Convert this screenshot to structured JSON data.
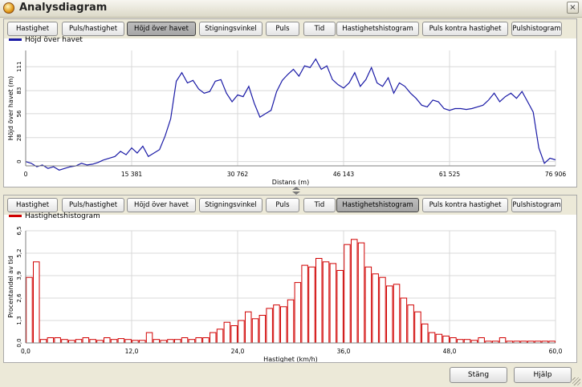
{
  "window": {
    "title": "Analysdiagram",
    "close_label": "×"
  },
  "tabs": [
    "Hastighet",
    "Puls/hastighet",
    "Höjd över havet",
    "Stigningsvinkel",
    "Puls",
    "Tid",
    "Hastighetshistogram",
    "Puls kontra hastighet",
    "Pulshistogram"
  ],
  "top_active_tab": "Höjd över havet",
  "bottom_active_tab": "Hastighetshistogram",
  "colors": {
    "line": "#1a1aa6",
    "bars": "#d00000",
    "active_tab": "#b0b0b0"
  },
  "chart_data": [
    {
      "type": "line",
      "legend": "Höjd över havet",
      "xlabel": "Distans (m)",
      "ylabel": "Höjd över havet (m)",
      "xlim": [
        0,
        76906
      ],
      "ylim": [
        -5,
        130
      ],
      "xticks": [
        "0",
        "15 381",
        "30 762",
        "46 143",
        "61 525",
        "76 906"
      ],
      "yticks": [
        "0",
        "28",
        "56",
        "83",
        "111"
      ],
      "x": [
        0,
        1000,
        2000,
        3000,
        4000,
        5000,
        6000,
        7000,
        8000,
        9000,
        10000,
        11000,
        12000,
        13000,
        14000,
        15000,
        16000,
        17000,
        18000,
        19000,
        20000,
        21000,
        22000,
        23000,
        24000,
        25000,
        26000,
        27000,
        28000,
        29000,
        30000,
        31000,
        32000,
        33000,
        34000,
        35000,
        36000,
        37000,
        38000,
        39000,
        40000,
        41000,
        42000,
        43000,
        44000,
        45000,
        46000,
        47000,
        48000,
        49000,
        50000,
        51000,
        52000,
        53000,
        54000,
        55000,
        56000,
        57000,
        58000,
        59000,
        60000,
        61000,
        62000,
        63000,
        64000,
        65000,
        66000,
        67000,
        68000,
        69000,
        70000,
        71000,
        72000,
        73000,
        74000,
        75000,
        76000,
        76906
      ],
      "y": [
        0,
        -2,
        -6,
        -4,
        -8,
        -6,
        -10,
        -8,
        -6,
        -5,
        -2,
        -4,
        -3,
        -1,
        2,
        4,
        6,
        12,
        8,
        16,
        10,
        18,
        6,
        10,
        14,
        30,
        50,
        94,
        104,
        92,
        95,
        85,
        80,
        82,
        94,
        96,
        80,
        70,
        78,
        76,
        88,
        68,
        52,
        56,
        60,
        82,
        95,
        102,
        108,
        100,
        112,
        110,
        120,
        108,
        112,
        96,
        90,
        86,
        92,
        104,
        88,
        96,
        110,
        92,
        88,
        98,
        80,
        92,
        88,
        80,
        74,
        66,
        64,
        72,
        70,
        62,
        60,
        62,
        62,
        61,
        62,
        64,
        66,
        72,
        80,
        70,
        76,
        80,
        74,
        82,
        70,
        58,
        16,
        -2,
        4,
        2
      ],
      "note": ""
    },
    {
      "type": "bar",
      "legend": "Hastighetshistogram",
      "xlabel": "Hastighet (km/h)",
      "ylabel": "Procentandel av tid",
      "xlim": [
        0,
        60
      ],
      "ylim": [
        0,
        6.5
      ],
      "xticks": [
        "0,0",
        "12,0",
        "24,0",
        "36,0",
        "48,0",
        "60,0"
      ],
      "yticks": [
        "0,0",
        "1,3",
        "2,6",
        "3,9",
        "5,2",
        "6,5"
      ],
      "bar_width": 0.8,
      "x": [
        0.0,
        0.8,
        1.6,
        2.4,
        3.2,
        4.0,
        4.8,
        5.6,
        6.4,
        7.2,
        8.0,
        8.8,
        9.6,
        10.4,
        11.2,
        12.0,
        12.8,
        13.6,
        14.4,
        15.2,
        16.0,
        16.8,
        17.6,
        18.4,
        19.2,
        20.0,
        20.8,
        21.6,
        22.4,
        23.2,
        24.0,
        24.8,
        25.6,
        26.4,
        27.2,
        28.0,
        28.8,
        29.6,
        30.4,
        31.2,
        32.0,
        32.8,
        33.6,
        34.4,
        35.2,
        36.0,
        36.8,
        37.6,
        38.4,
        39.2,
        40.0,
        40.8,
        41.6,
        42.4,
        43.2,
        44.0,
        44.8,
        45.6,
        46.4,
        47.2,
        48.0,
        48.8,
        49.6,
        50.4,
        51.2,
        52.0,
        52.8,
        53.6,
        54.4,
        55.2,
        56.0,
        56.8,
        57.6,
        58.4,
        59.2
      ],
      "values": [
        3.8,
        4.7,
        0.2,
        0.3,
        0.3,
        0.2,
        0.15,
        0.2,
        0.3,
        0.2,
        0.15,
        0.3,
        0.2,
        0.25,
        0.2,
        0.15,
        0.15,
        0.6,
        0.2,
        0.15,
        0.2,
        0.2,
        0.3,
        0.2,
        0.3,
        0.3,
        0.6,
        0.8,
        1.2,
        1.0,
        1.3,
        1.8,
        1.4,
        1.6,
        2.0,
        2.2,
        2.1,
        2.5,
        3.5,
        4.5,
        4.4,
        4.9,
        4.7,
        4.6,
        4.2,
        5.7,
        6.0,
        5.8,
        4.4,
        4.0,
        3.8,
        3.3,
        3.4,
        2.6,
        2.2,
        1.8,
        1.1,
        0.6,
        0.5,
        0.4,
        0.3,
        0.2,
        0.2,
        0.15,
        0.3,
        0.1,
        0.1,
        0.3,
        0.1,
        0.1,
        0.1,
        0.1,
        0.1,
        0.1,
        0.1
      ],
      "note": ""
    }
  ],
  "footer": {
    "close_label": "Stäng",
    "help_label": "Hjälp"
  }
}
